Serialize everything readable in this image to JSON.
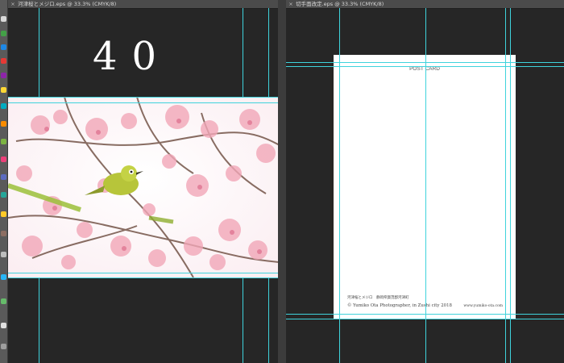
{
  "left_window": {
    "tab_title": "河津桜とメジロ.eps @ 33.3% (CMYK/8)",
    "page_number": "40"
  },
  "right_window": {
    "tab_title": "切手面改定.eps @ 33.3% (CMYK/8)",
    "postcard": {
      "title": "POST CARD",
      "caption": "河津桜とメジロ　静岡県賀茂郡河津町",
      "copyright": "© Yumiko Ota Photographer, in Zushi city 2018",
      "website": "www.yumiko-ota.com"
    }
  },
  "colors": {
    "canvas": "#262626",
    "guide": "#3fd3dc",
    "blossom": "#f2a7b8",
    "bird": "#b7c53a"
  },
  "icons": {
    "dock": [
      "app-icon"
    ],
    "tab_close": "close-icon",
    "photo_subject": "bird-on-cherry-blossom"
  }
}
